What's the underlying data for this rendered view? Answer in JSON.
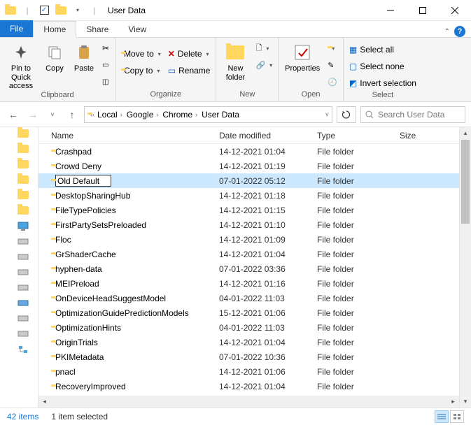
{
  "title": "User Data",
  "tabs": {
    "file": "File",
    "home": "Home",
    "share": "Share",
    "view": "View"
  },
  "ribbon": {
    "clipboard": {
      "label": "Clipboard",
      "pin": "Pin to Quick\naccess",
      "copy": "Copy",
      "paste": "Paste"
    },
    "organize": {
      "label": "Organize",
      "moveto": "Move to",
      "copyto": "Copy to",
      "delete": "Delete",
      "rename": "Rename"
    },
    "new": {
      "label": "New",
      "newfolder": "New\nfolder"
    },
    "open": {
      "label": "Open",
      "properties": "Properties"
    },
    "select": {
      "label": "Select",
      "all": "Select all",
      "none": "Select none",
      "invert": "Invert selection"
    }
  },
  "breadcrumbs": [
    "Local",
    "Google",
    "Chrome",
    "User Data"
  ],
  "search_placeholder": "Search User Data",
  "columns": {
    "name": "Name",
    "date": "Date modified",
    "type": "Type",
    "size": "Size"
  },
  "files": [
    {
      "name": "Crashpad",
      "date": "14-12-2021 01:04",
      "type": "File folder"
    },
    {
      "name": "Crowd Deny",
      "date": "14-12-2021 01:19",
      "type": "File folder"
    },
    {
      "name": "Old Default",
      "date": "07-01-2022 05:12",
      "type": "File folder",
      "selected": true,
      "rename": true
    },
    {
      "name": "DesktopSharingHub",
      "date": "14-12-2021 01:18",
      "type": "File folder"
    },
    {
      "name": "FileTypePolicies",
      "date": "14-12-2021 01:15",
      "type": "File folder"
    },
    {
      "name": "FirstPartySetsPreloaded",
      "date": "14-12-2021 01:10",
      "type": "File folder"
    },
    {
      "name": "Floc",
      "date": "14-12-2021 01:09",
      "type": "File folder"
    },
    {
      "name": "GrShaderCache",
      "date": "14-12-2021 01:04",
      "type": "File folder"
    },
    {
      "name": "hyphen-data",
      "date": "07-01-2022 03:36",
      "type": "File folder"
    },
    {
      "name": "MEIPreload",
      "date": "14-12-2021 01:16",
      "type": "File folder"
    },
    {
      "name": "OnDeviceHeadSuggestModel",
      "date": "04-01-2022 11:03",
      "type": "File folder"
    },
    {
      "name": "OptimizationGuidePredictionModels",
      "date": "15-12-2021 01:06",
      "type": "File folder"
    },
    {
      "name": "OptimizationHints",
      "date": "04-01-2022 11:03",
      "type": "File folder"
    },
    {
      "name": "OriginTrials",
      "date": "14-12-2021 01:04",
      "type": "File folder"
    },
    {
      "name": "PKIMetadata",
      "date": "07-01-2022 10:36",
      "type": "File folder"
    },
    {
      "name": "pnacl",
      "date": "14-12-2021 01:06",
      "type": "File folder"
    },
    {
      "name": "RecoveryImproved",
      "date": "14-12-2021 01:04",
      "type": "File folder"
    }
  ],
  "status": {
    "count": "42 items",
    "selected": "1 item selected"
  }
}
